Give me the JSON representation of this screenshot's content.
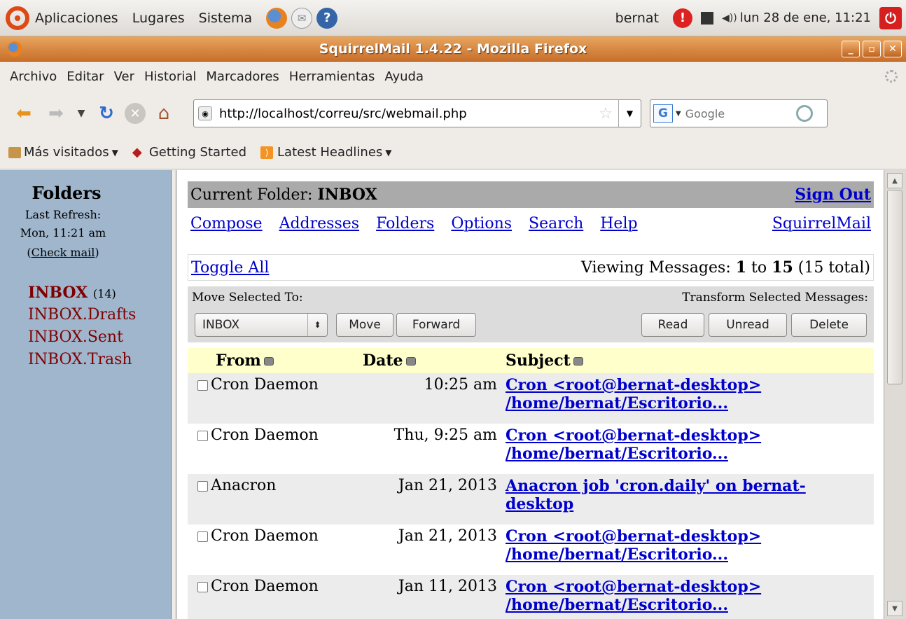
{
  "panel": {
    "menus": [
      "Aplicaciones",
      "Lugares",
      "Sistema"
    ],
    "user": "bernat",
    "clock": "lun 28 de ene, 11:21"
  },
  "window": {
    "title": "SquirrelMail 1.4.22 - Mozilla Firefox",
    "menu": [
      "Archivo",
      "Editar",
      "Ver",
      "Historial",
      "Marcadores",
      "Herramientas",
      "Ayuda"
    ]
  },
  "navbar": {
    "url": "http://localhost/correu/src/webmail.php",
    "search_placeholder": "Google"
  },
  "bookmarks": [
    "Más visitados",
    "Getting Started",
    "Latest Headlines"
  ],
  "sidebar": {
    "title": "Folders",
    "refresh_label": "Last Refresh:",
    "refresh_time": "Mon, 11:21 am",
    "check_mail": "Check mail",
    "folders": [
      {
        "name": "INBOX",
        "count": "(14)"
      },
      {
        "name": "INBOX.Drafts"
      },
      {
        "name": "INBOX.Sent"
      },
      {
        "name": "INBOX.Trash"
      }
    ]
  },
  "main": {
    "current_folder_label": "Current Folder:",
    "current_folder": "INBOX",
    "sign_out": "Sign Out",
    "links": [
      "Compose",
      "Addresses",
      "Folders",
      "Options",
      "Search",
      "Help"
    ],
    "squirrelmail": "SquirrelMail",
    "toggle_all": "Toggle All",
    "viewing_label": "Viewing Messages:",
    "viewing_from": "1",
    "viewing_to_word": "to",
    "viewing_to": "15",
    "viewing_total": "(15 total)",
    "move_label": "Move Selected To:",
    "transform_label": "Transform Selected Messages:",
    "move_select": "INBOX",
    "buttons": {
      "move": "Move",
      "forward": "Forward",
      "read": "Read",
      "unread": "Unread",
      "delete": "Delete"
    },
    "headers": {
      "from": "From",
      "date": "Date",
      "subject": "Subject"
    },
    "messages": [
      {
        "from": "Cron Daemon",
        "date": "10:25 am",
        "subject_1": "Cron <root@bernat-desktop>",
        "subject_2": "/home/bernat/Escritorio..."
      },
      {
        "from": "Cron Daemon",
        "date": "Thu, 9:25 am",
        "subject_1": "Cron <root@bernat-desktop>",
        "subject_2": "/home/bernat/Escritorio..."
      },
      {
        "from": "Anacron",
        "date": "Jan 21, 2013",
        "subject_1": "Anacron job 'cron.daily' on bernat-",
        "subject_2": "desktop"
      },
      {
        "from": "Cron Daemon",
        "date": "Jan 21, 2013",
        "subject_1": "Cron <root@bernat-desktop>",
        "subject_2": "/home/bernat/Escritorio..."
      },
      {
        "from": "Cron Daemon",
        "date": "Jan 11, 2013",
        "subject_1": "Cron <root@bernat-desktop>",
        "subject_2": "/home/bernat/Escritorio..."
      }
    ]
  }
}
